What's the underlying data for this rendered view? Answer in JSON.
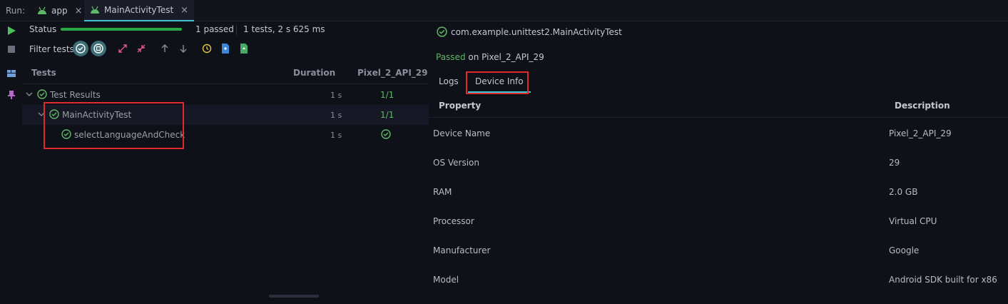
{
  "run_bar": {
    "label": "Run:",
    "tabs": [
      {
        "label": "app",
        "close": "×"
      },
      {
        "label": "MainActivityTest",
        "close": "×"
      }
    ]
  },
  "status": {
    "label": "Status",
    "progress": 1.0,
    "passed": "1 passed",
    "summary": "1 tests, 2 s 625 ms"
  },
  "filter": {
    "label": "Filter tests:"
  },
  "tree": {
    "columns": {
      "tests": "Tests",
      "duration": "Duration",
      "device": "Pixel_2_API_29"
    },
    "rows": [
      {
        "name": "Test Results",
        "duration": "1 s",
        "result": "1/1"
      },
      {
        "name": "MainActivityTest",
        "duration": "1 s",
        "result": "1/1"
      },
      {
        "name": "selectLanguageAndCheck",
        "duration": "1 s",
        "result": ""
      }
    ]
  },
  "details": {
    "title": "com.example.unittest2.MainActivityTest",
    "passed_word": "Passed",
    "passed_rest": " on Pixel_2_API_29",
    "tabs": {
      "logs": "Logs",
      "device_info": "Device Info"
    },
    "columns": {
      "property": "Property",
      "description": "Description"
    },
    "properties": [
      {
        "property": "Device Name",
        "description": "Pixel_2_API_29"
      },
      {
        "property": "OS Version",
        "description": "29"
      },
      {
        "property": "RAM",
        "description": "2.0 GB"
      },
      {
        "property": "Processor",
        "description": "Virtual CPU"
      },
      {
        "property": "Manufacturer",
        "description": "Google"
      },
      {
        "property": "Model",
        "description": "Android SDK built for x86"
      }
    ]
  },
  "colors": {
    "accent": "#3ec3d8",
    "pass": "#5fb866",
    "progress": "#27a844",
    "highlight": "#e02b2b"
  }
}
